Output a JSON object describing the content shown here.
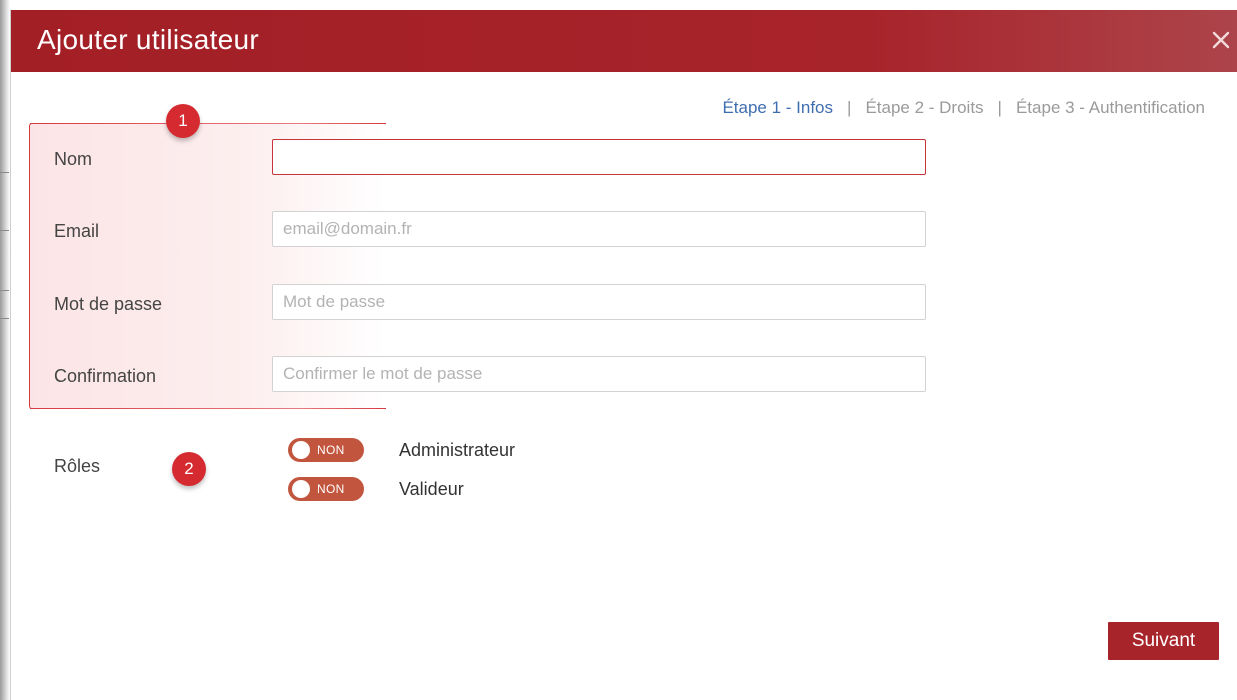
{
  "modal": {
    "title": "Ajouter utilisateur",
    "close_icon": "close-icon"
  },
  "steps": [
    {
      "label": "Étape 1 - Infos",
      "active": true
    },
    {
      "label": "Étape 2 - Droits",
      "active": false
    },
    {
      "label": "Étape 3 - Authentification",
      "active": false
    }
  ],
  "steps_separator": "|",
  "badges": {
    "first": "1",
    "second": "2"
  },
  "form": {
    "nom": {
      "label": "Nom",
      "value": "",
      "placeholder": ""
    },
    "email": {
      "label": "Email",
      "value": "",
      "placeholder": "email@domain.fr"
    },
    "password": {
      "label": "Mot de passe",
      "value": "",
      "placeholder": "Mot de passe"
    },
    "confirmation": {
      "label": "Confirmation",
      "value": "",
      "placeholder": "Confirmer le mot de passe"
    }
  },
  "roles": {
    "label": "Rôles",
    "items": [
      {
        "name": "Administrateur",
        "toggle_text": "NON",
        "enabled": false
      },
      {
        "name": "Valideur",
        "toggle_text": "NON",
        "enabled": false
      }
    ]
  },
  "footer": {
    "next_label": "Suivant"
  },
  "colors": {
    "header": "#a31f26",
    "accent_step": "#3f6eb0",
    "badge": "#d52b30",
    "toggle_off": "#c2553e",
    "next_button": "#a8242b"
  }
}
